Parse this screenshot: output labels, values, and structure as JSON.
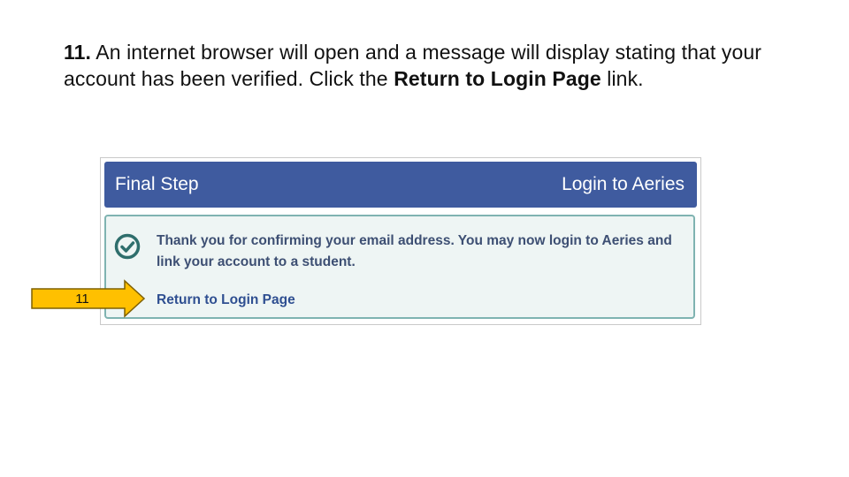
{
  "instruction": {
    "step_number": "11.",
    "text_before": "An internet browser will open and a message will display stating that your account has been verified. Click the",
    "bold_link_name": "Return to Login Page",
    "text_after": "link."
  },
  "screenshot": {
    "header_left": "Final Step",
    "header_right": "Login to Aeries",
    "message": "Thank you for confirming your email address. You may now login to Aeries and link your account to a student.",
    "link_label": "Return to Login Page",
    "icon": "check-circle-icon"
  },
  "callout": {
    "step": "11",
    "icon": "arrow-right-icon"
  },
  "colors": {
    "header_bg": "#3f5b9f",
    "body_bg": "#eef5f4",
    "body_border": "#7fb3b1",
    "check_color": "#2e6e6c",
    "callout_fill": "#ffc000"
  }
}
